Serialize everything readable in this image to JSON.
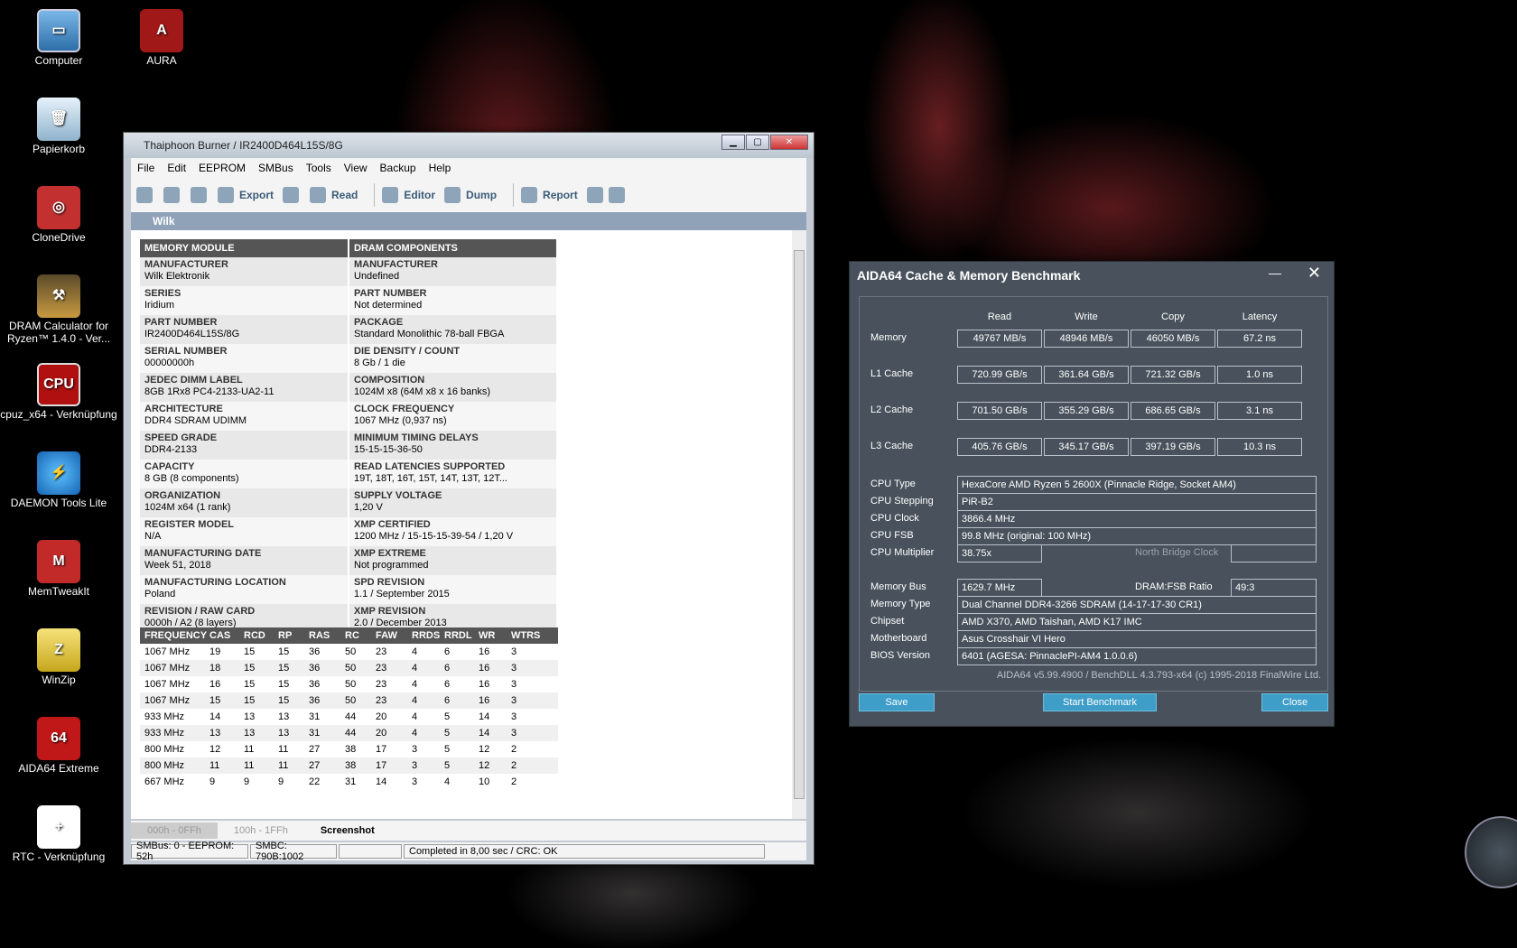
{
  "desktop_icons": [
    {
      "label": "Computer",
      "glyph": "▭"
    },
    {
      "label": "AURA",
      "glyph": "A"
    },
    {
      "label": "Papierkorb",
      "glyph": "🗑"
    },
    {
      "label": "CloneDrive",
      "glyph": "◎"
    },
    {
      "label": "DRAM Calculator for Ryzen™ 1.4.0 - Ver...",
      "glyph": "⚒"
    },
    {
      "label": "cpuz_x64 - Verknüpfung",
      "glyph": "CPU"
    },
    {
      "label": "DAEMON Tools Lite",
      "glyph": "⚡"
    },
    {
      "label": "MemTweakIt",
      "glyph": "M"
    },
    {
      "label": "WinZip",
      "glyph": "Z"
    },
    {
      "label": "AIDA64 Extreme",
      "glyph": "64"
    },
    {
      "label": "RTC - Verknüpfung",
      "glyph": "+"
    }
  ],
  "thaiphoon": {
    "title": "Thaiphoon Burner / IR2400D464L15S/8G",
    "menu": [
      "File",
      "Edit",
      "EEPROM",
      "SMBus",
      "Tools",
      "View",
      "Backup",
      "Help"
    ],
    "toolbar": [
      "Export",
      "Read",
      "Editor",
      "Dump",
      "Report"
    ],
    "section": "Wilk",
    "headers": [
      "MEMORY MODULE",
      "DRAM COMPONENTS"
    ],
    "rows": [
      [
        {
          "k": "MANUFACTURER",
          "v": "Wilk Elektronik"
        },
        {
          "k": "MANUFACTURER",
          "v": "Undefined"
        }
      ],
      [
        {
          "k": "SERIES",
          "v": "Iridium"
        },
        {
          "k": "PART NUMBER",
          "v": "Not determined"
        }
      ],
      [
        {
          "k": "PART NUMBER",
          "v": "IR2400D464L15S/8G"
        },
        {
          "k": "PACKAGE",
          "v": "Standard Monolithic 78-ball FBGA"
        }
      ],
      [
        {
          "k": "SERIAL NUMBER",
          "v": "00000000h"
        },
        {
          "k": "DIE DENSITY / COUNT",
          "v": "8 Gb / 1 die"
        }
      ],
      [
        {
          "k": "JEDEC DIMM LABEL",
          "v": "8GB 1Rx8 PC4-2133-UA2-11"
        },
        {
          "k": "COMPOSITION",
          "v": "1024M x8 (64M x8 x 16 banks)"
        }
      ],
      [
        {
          "k": "ARCHITECTURE",
          "v": "DDR4 SDRAM UDIMM"
        },
        {
          "k": "CLOCK FREQUENCY",
          "v": "1067 MHz (0,937 ns)"
        }
      ],
      [
        {
          "k": "SPEED GRADE",
          "v": "DDR4-2133"
        },
        {
          "k": "MINIMUM TIMING DELAYS",
          "v": "15-15-15-36-50"
        }
      ],
      [
        {
          "k": "CAPACITY",
          "v": "8 GB (8 components)"
        },
        {
          "k": "READ LATENCIES SUPPORTED",
          "v": "19T, 18T, 16T, 15T, 14T, 13T, 12T..."
        }
      ],
      [
        {
          "k": "ORGANIZATION",
          "v": "1024M x64 (1 rank)"
        },
        {
          "k": "SUPPLY VOLTAGE",
          "v": "1,20 V"
        }
      ],
      [
        {
          "k": "REGISTER MODEL",
          "v": "N/A"
        },
        {
          "k": "XMP CERTIFIED",
          "v": "1200 MHz / 15-15-15-39-54 / 1,20 V"
        }
      ],
      [
        {
          "k": "MANUFACTURING DATE",
          "v": "Week 51, 2018"
        },
        {
          "k": "XMP EXTREME",
          "v": "Not programmed"
        }
      ],
      [
        {
          "k": "MANUFACTURING LOCATION",
          "v": "Poland"
        },
        {
          "k": "SPD REVISION",
          "v": "1.1 / September 2015"
        }
      ],
      [
        {
          "k": "REVISION / RAW CARD",
          "v": "0000h / A2 (8 layers)"
        },
        {
          "k": "XMP REVISION",
          "v": "2.0 / December 2013"
        }
      ]
    ],
    "timing_header": [
      "FREQUENCY",
      "CAS",
      "RCD",
      "RP",
      "RAS",
      "RC",
      "FAW",
      "RRDS",
      "RRDL",
      "WR",
      "WTRS"
    ],
    "timing_rows": [
      [
        "1067 MHz",
        "19",
        "15",
        "15",
        "36",
        "50",
        "23",
        "4",
        "6",
        "16",
        "3"
      ],
      [
        "1067 MHz",
        "18",
        "15",
        "15",
        "36",
        "50",
        "23",
        "4",
        "6",
        "16",
        "3"
      ],
      [
        "1067 MHz",
        "16",
        "15",
        "15",
        "36",
        "50",
        "23",
        "4",
        "6",
        "16",
        "3"
      ],
      [
        "1067 MHz",
        "15",
        "15",
        "15",
        "36",
        "50",
        "23",
        "4",
        "6",
        "16",
        "3"
      ],
      [
        "933 MHz",
        "14",
        "13",
        "13",
        "31",
        "44",
        "20",
        "4",
        "5",
        "14",
        "3"
      ],
      [
        "933 MHz",
        "13",
        "13",
        "13",
        "31",
        "44",
        "20",
        "4",
        "5",
        "14",
        "3"
      ],
      [
        "800 MHz",
        "12",
        "11",
        "11",
        "27",
        "38",
        "17",
        "3",
        "5",
        "12",
        "2"
      ],
      [
        "800 MHz",
        "11",
        "11",
        "11",
        "27",
        "38",
        "17",
        "3",
        "5",
        "12",
        "2"
      ],
      [
        "667 MHz",
        "9",
        "9",
        "9",
        "22",
        "31",
        "14",
        "3",
        "4",
        "10",
        "2"
      ]
    ],
    "footer_header": [
      "FREQUENCY",
      "CAS",
      "RCD",
      "RP",
      "RAS",
      "FAW",
      "RRDS",
      "RRDL"
    ],
    "tabs": [
      "000h - 0FFh",
      "100h - 1FFh",
      "Screenshot"
    ],
    "status": [
      "SMBus: 0 - EEPROM: 52h",
      "SMBC: 790B:1002",
      "",
      "Completed in 8,00 sec / CRC: OK"
    ]
  },
  "aida": {
    "title": "AIDA64 Cache & Memory Benchmark",
    "columns": [
      "Read",
      "Write",
      "Copy",
      "Latency"
    ],
    "bench": [
      {
        "label": "Memory",
        "vals": [
          "49767 MB/s",
          "48946 MB/s",
          "46050 MB/s",
          "67.2 ns"
        ]
      },
      {
        "label": "L1 Cache",
        "vals": [
          "720.99 GB/s",
          "361.64 GB/s",
          "721.32 GB/s",
          "1.0 ns"
        ]
      },
      {
        "label": "L2 Cache",
        "vals": [
          "701.50 GB/s",
          "355.29 GB/s",
          "686.65 GB/s",
          "3.1 ns"
        ]
      },
      {
        "label": "L3 Cache",
        "vals": [
          "405.76 GB/s",
          "345.17 GB/s",
          "397.19 GB/s",
          "10.3 ns"
        ]
      }
    ],
    "cpu_type_label": "CPU Type",
    "cpu_type": "HexaCore AMD Ryzen 5 2600X  (Pinnacle Ridge, Socket AM4)",
    "cpu_stepping_label": "CPU Stepping",
    "cpu_stepping": "PiR-B2",
    "cpu_clock_label": "CPU Clock",
    "cpu_clock": "3866.4 MHz",
    "cpu_fsb_label": "CPU FSB",
    "cpu_fsb": "99.8 MHz  (original: 100 MHz)",
    "cpu_mult_label": "CPU Multiplier",
    "cpu_mult": "38.75x",
    "nb_clock_label": "North Bridge Clock",
    "nb_clock": "",
    "mem_bus_label": "Memory Bus",
    "mem_bus": "1629.7 MHz",
    "ratio_label": "DRAM:FSB Ratio",
    "ratio": "49:3",
    "mem_type_label": "Memory Type",
    "mem_type": "Dual Channel DDR4-3266 SDRAM  (14-17-17-30 CR1)",
    "chipset_label": "Chipset",
    "chipset": "AMD X370, AMD Taishan, AMD K17 IMC",
    "mobo_label": "Motherboard",
    "mobo": "Asus Crosshair VI Hero",
    "bios_label": "BIOS Version",
    "bios": "6401  (AGESA: PinnaclePI-AM4 1.0.0.6)",
    "version": "AIDA64 v5.99.4900 / BenchDLL 4.3.793-x64  (c) 1995-2018 FinalWire Ltd.",
    "buttons": [
      "Save",
      "Start Benchmark",
      "Close"
    ]
  }
}
